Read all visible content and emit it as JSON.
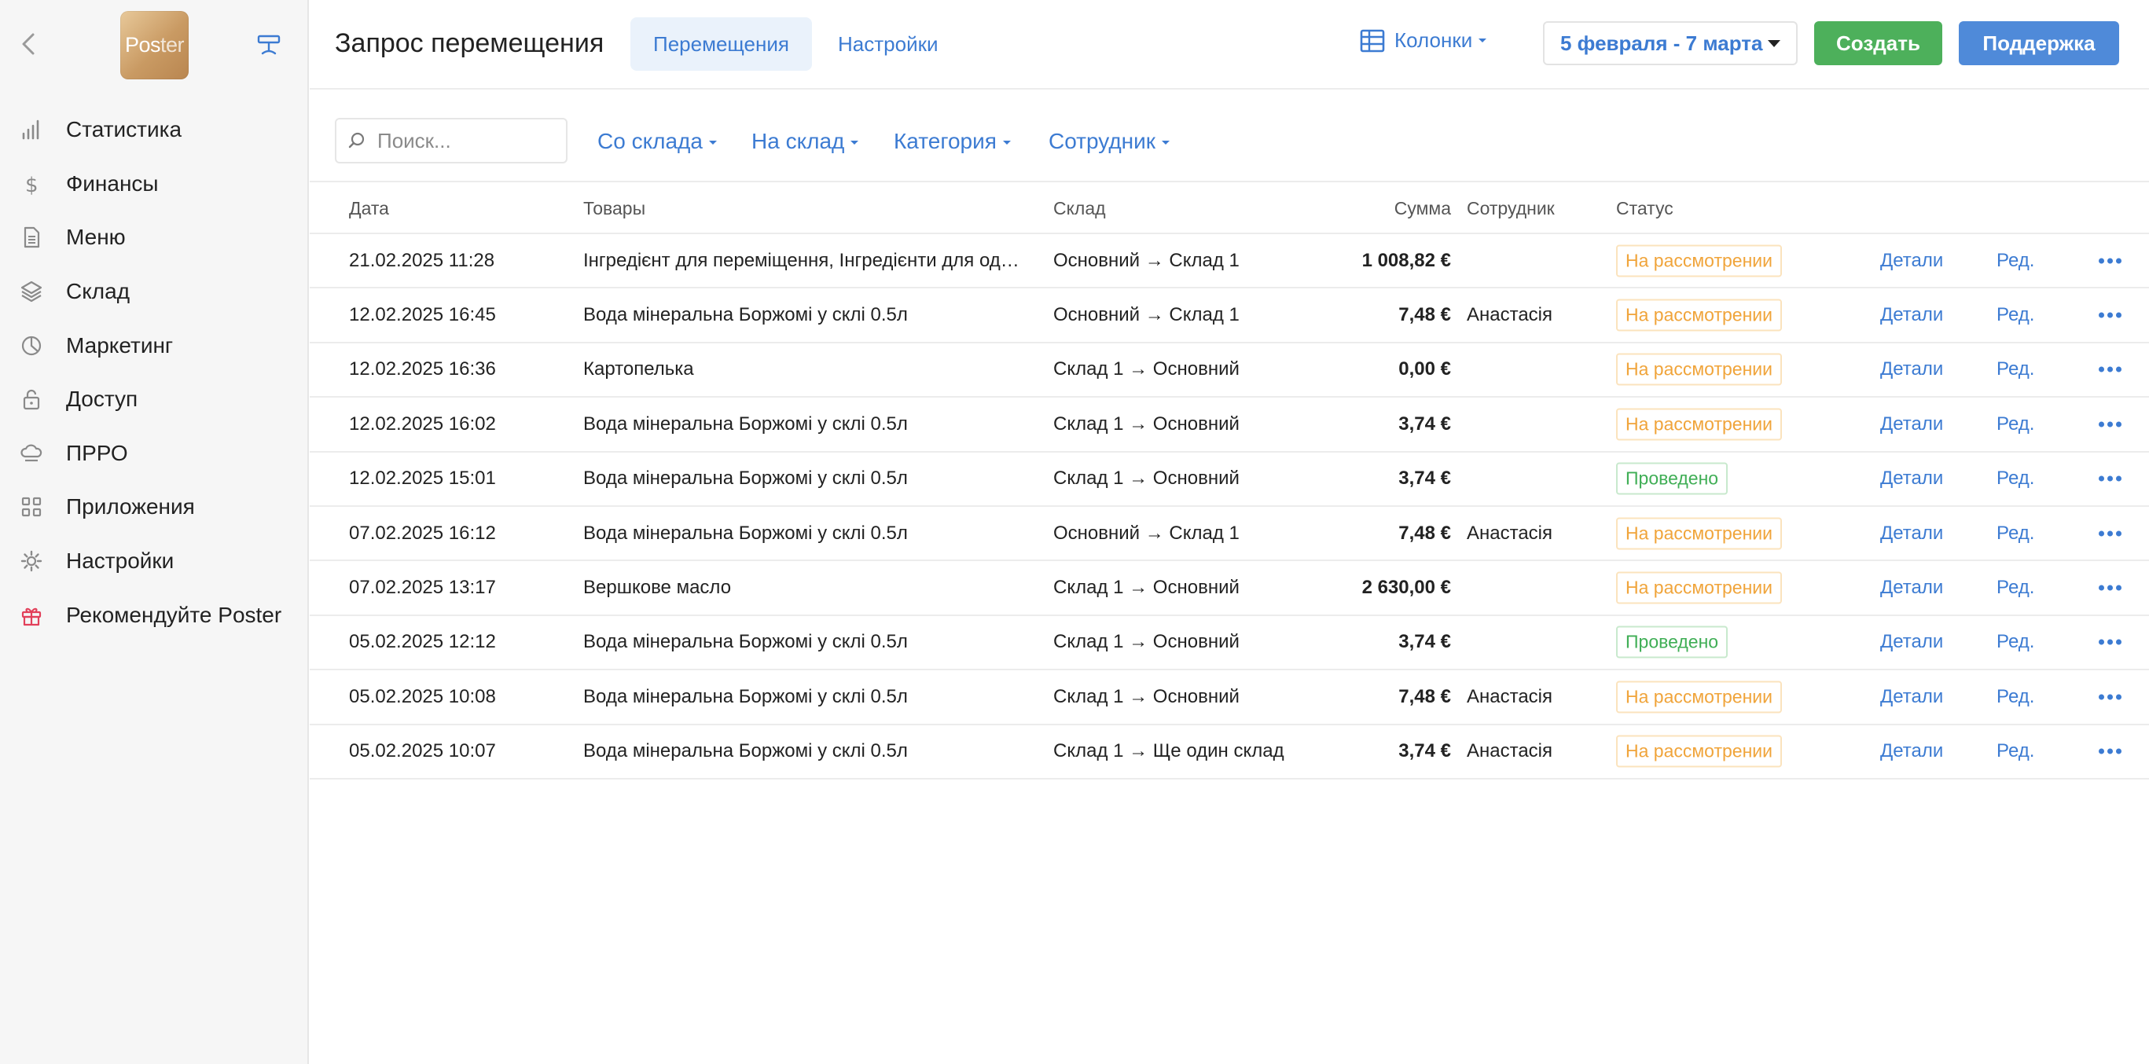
{
  "colors": {
    "accent": "#3c7bd2",
    "create": "#4db05b",
    "support": "#4f8ad9",
    "pending": "#f0a43a",
    "done": "#3fae55",
    "gift": "#e2405a"
  },
  "sidebar": {
    "logo": {
      "part1": "Pos",
      "part2": "ter"
    },
    "items": [
      {
        "label": "Статистика",
        "icon": "bar-chart-icon"
      },
      {
        "label": "Финансы",
        "icon": "dollar-icon"
      },
      {
        "label": "Меню",
        "icon": "document-icon"
      },
      {
        "label": "Склад",
        "icon": "layers-icon"
      },
      {
        "label": "Маркетинг",
        "icon": "pie-chart-icon"
      },
      {
        "label": "Доступ",
        "icon": "lock-icon"
      },
      {
        "label": "ПРРО",
        "icon": "cloud-icon"
      },
      {
        "label": "Приложения",
        "icon": "grid-icon"
      },
      {
        "label": "Настройки",
        "icon": "gear-icon"
      },
      {
        "label": "Рекомендуйте Poster",
        "icon": "gift-icon"
      }
    ]
  },
  "header": {
    "title": "Запрос перемещения",
    "tabs": [
      {
        "label": "Перемещения"
      },
      {
        "label": "Настройки"
      }
    ],
    "columns_label": "Колонки",
    "date_range": "5 февраля - 7 марта",
    "create_label": "Создать",
    "support_label": "Поддержка"
  },
  "filters": {
    "search_placeholder": "Поиск...",
    "from_warehouse": "Со склада",
    "to_warehouse": "На склад",
    "category": "Категория",
    "employee": "Сотрудник"
  },
  "table": {
    "headers": {
      "date": "Дата",
      "goods": "Товары",
      "warehouse": "Склад",
      "sum": "Сумма",
      "employee": "Сотрудник",
      "status": "Статус"
    },
    "details_label": "Детали",
    "edit_label": "Ред.",
    "rows": [
      {
        "date": "21.02.2025 11:28",
        "goods": "Інгредієнт для переміщення, Інгредієнти для одні…",
        "warehouse": "Основний → Склад 1",
        "sum": "1 008,82 €",
        "employee": "",
        "status": "На рассмотрении",
        "status_type": "pending"
      },
      {
        "date": "12.02.2025 16:45",
        "goods": "Вода мінеральна Боржомі у склі 0.5л",
        "warehouse": "Основний → Склад 1",
        "sum": "7,48 €",
        "employee": "Анастасія",
        "status": "На рассмотрении",
        "status_type": "pending"
      },
      {
        "date": "12.02.2025 16:36",
        "goods": "Картопелька",
        "warehouse": "Склад 1 → Основний",
        "sum": "0,00 €",
        "employee": "",
        "status": "На рассмотрении",
        "status_type": "pending"
      },
      {
        "date": "12.02.2025 16:02",
        "goods": "Вода мінеральна Боржомі у склі 0.5л",
        "warehouse": "Склад 1 → Основний",
        "sum": "3,74 €",
        "employee": "",
        "status": "На рассмотрении",
        "status_type": "pending"
      },
      {
        "date": "12.02.2025 15:01",
        "goods": "Вода мінеральна Боржомі у склі 0.5л",
        "warehouse": "Склад 1 → Основний",
        "sum": "3,74 €",
        "employee": "",
        "status": "Проведено",
        "status_type": "done"
      },
      {
        "date": "07.02.2025 16:12",
        "goods": "Вода мінеральна Боржомі у склі 0.5л",
        "warehouse": "Основний → Склад 1",
        "sum": "7,48 €",
        "employee": "Анастасія",
        "status": "На рассмотрении",
        "status_type": "pending"
      },
      {
        "date": "07.02.2025 13:17",
        "goods": "Вершкове масло",
        "warehouse": "Склад 1 → Основний",
        "sum": "2 630,00 €",
        "employee": "",
        "status": "На рассмотрении",
        "status_type": "pending"
      },
      {
        "date": "05.02.2025 12:12",
        "goods": "Вода мінеральна Боржомі у склі 0.5л",
        "warehouse": "Склад 1 → Основний",
        "sum": "3,74 €",
        "employee": "",
        "status": "Проведено",
        "status_type": "done"
      },
      {
        "date": "05.02.2025 10:08",
        "goods": "Вода мінеральна Боржомі у склі 0.5л",
        "warehouse": "Склад 1 → Основний",
        "sum": "7,48 €",
        "employee": "Анастасія",
        "status": "На рассмотрении",
        "status_type": "pending"
      },
      {
        "date": "05.02.2025 10:07",
        "goods": "Вода мінеральна Боржомі у склі 0.5л",
        "warehouse": "Склад 1 → Ще один склад",
        "sum": "3,74 €",
        "employee": "Анастасія",
        "status": "На рассмотрении",
        "status_type": "pending"
      }
    ]
  }
}
